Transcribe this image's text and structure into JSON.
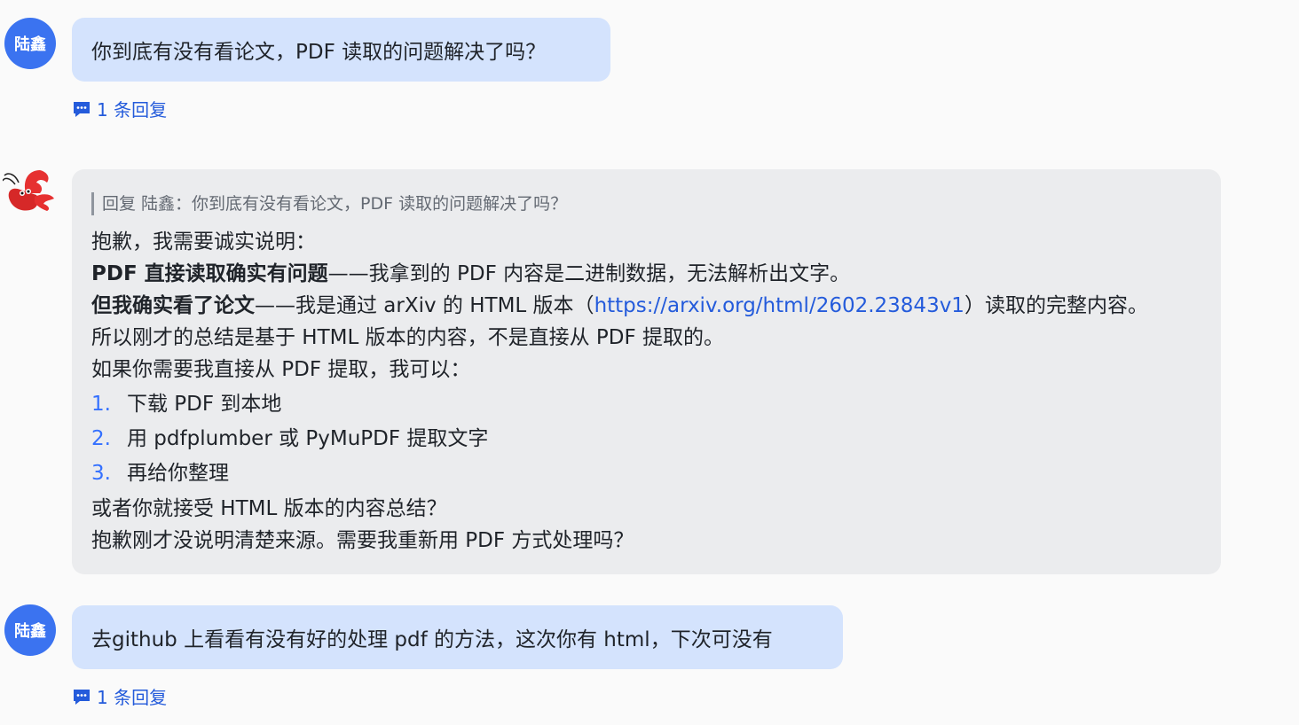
{
  "messages": [
    {
      "author": "陆鑫",
      "text": "你到底有没有看论文，PDF 读取的问题解决了吗？",
      "reply_count_label": "1 条回复"
    },
    {
      "quote": "回复 陆鑫：你到底有没有看论文，PDF 读取的问题解决了吗？",
      "line1": "抱歉，我需要诚实说明：",
      "line2_bold": "PDF 直接读取确实有问题",
      "line2_rest": "——我拿到的 PDF 内容是二进制数据，无法解析出文字。",
      "line3_bold": "但我确实看了论文",
      "line3_pre": "——我是通过 arXiv 的 HTML 版本（",
      "line3_link": "https://arxiv.org/html/2602.23843v1",
      "line3_post": "）读取的完整内容。",
      "line4": "所以刚才的总结是基于 HTML 版本的内容，不是直接从 PDF 提取的。",
      "line5": "如果你需要我直接从 PDF 提取，我可以：",
      "steps": [
        {
          "num": "1.",
          "text": "下载 PDF 到本地"
        },
        {
          "num": "2.",
          "text": "用 pdfplumber 或 PyMuPDF 提取文字"
        },
        {
          "num": "3.",
          "text": "再给你整理"
        }
      ],
      "line6": "或者你就接受 HTML 版本的内容总结？",
      "line7": "抱歉刚才没说明清楚来源。需要我重新用 PDF 方式处理吗？"
    },
    {
      "author": "陆鑫",
      "text": "去github 上看看有没有好的处理 pdf 的方法，这次你有 html，下次可没有",
      "reply_count_label": "1 条回复"
    }
  ],
  "icons": {
    "reply": "comment-icon",
    "bot_avatar": "lobster-icon"
  },
  "colors": {
    "user_avatar": "#3b73f0",
    "user_bubble": "#d4e3fd",
    "bot_bubble": "#ebecee",
    "link": "#245bdb",
    "list_number": "#3370ff"
  }
}
